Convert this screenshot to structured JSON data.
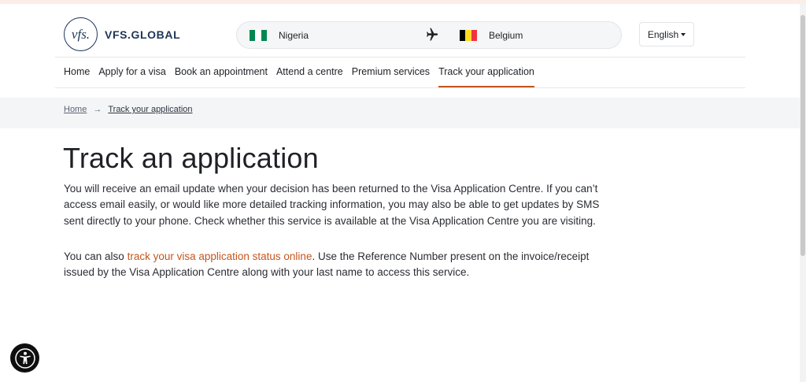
{
  "brand": {
    "logo_mark": "vfs.",
    "name": "VFS.GLOBAL"
  },
  "route": {
    "from_country": "Nigeria",
    "from_flag_colors": [
      "#008751",
      "#ffffff",
      "#008751"
    ],
    "icon": "plane-icon",
    "to_country": "Belgium",
    "to_flag_colors": [
      "#000000",
      "#fdda24",
      "#ef3340"
    ]
  },
  "language": {
    "selected": "English"
  },
  "nav": {
    "items": [
      {
        "label": "Home"
      },
      {
        "label": "Apply for a visa"
      },
      {
        "label": "Book an appointment"
      },
      {
        "label": "Attend a centre"
      },
      {
        "label": "Premium services"
      },
      {
        "label": "Track your application"
      }
    ],
    "active": "Track your application"
  },
  "breadcrumb": {
    "home": "Home",
    "current": "Track your application"
  },
  "main": {
    "title": "Track an application",
    "para1": "You will receive an email update when your decision has been returned to the Visa Application Centre. If you can’t access email easily, or would like more detailed tracking information, you may also be able to get updates by SMS sent directly to your phone. Check whether this service is available at the Visa Application Centre you are visiting.",
    "para2_prefix": "You can also ",
    "para2_link": "track your visa application status online",
    "para2_suffix": ". Use the Reference Number present on the invoice/receipt issued by the Visa Application Centre along with your last name to access this service."
  },
  "colors": {
    "accent": "#c4561d",
    "brand_navy": "#1d3557"
  },
  "accessibility": {
    "icon": "accessibility-icon"
  }
}
